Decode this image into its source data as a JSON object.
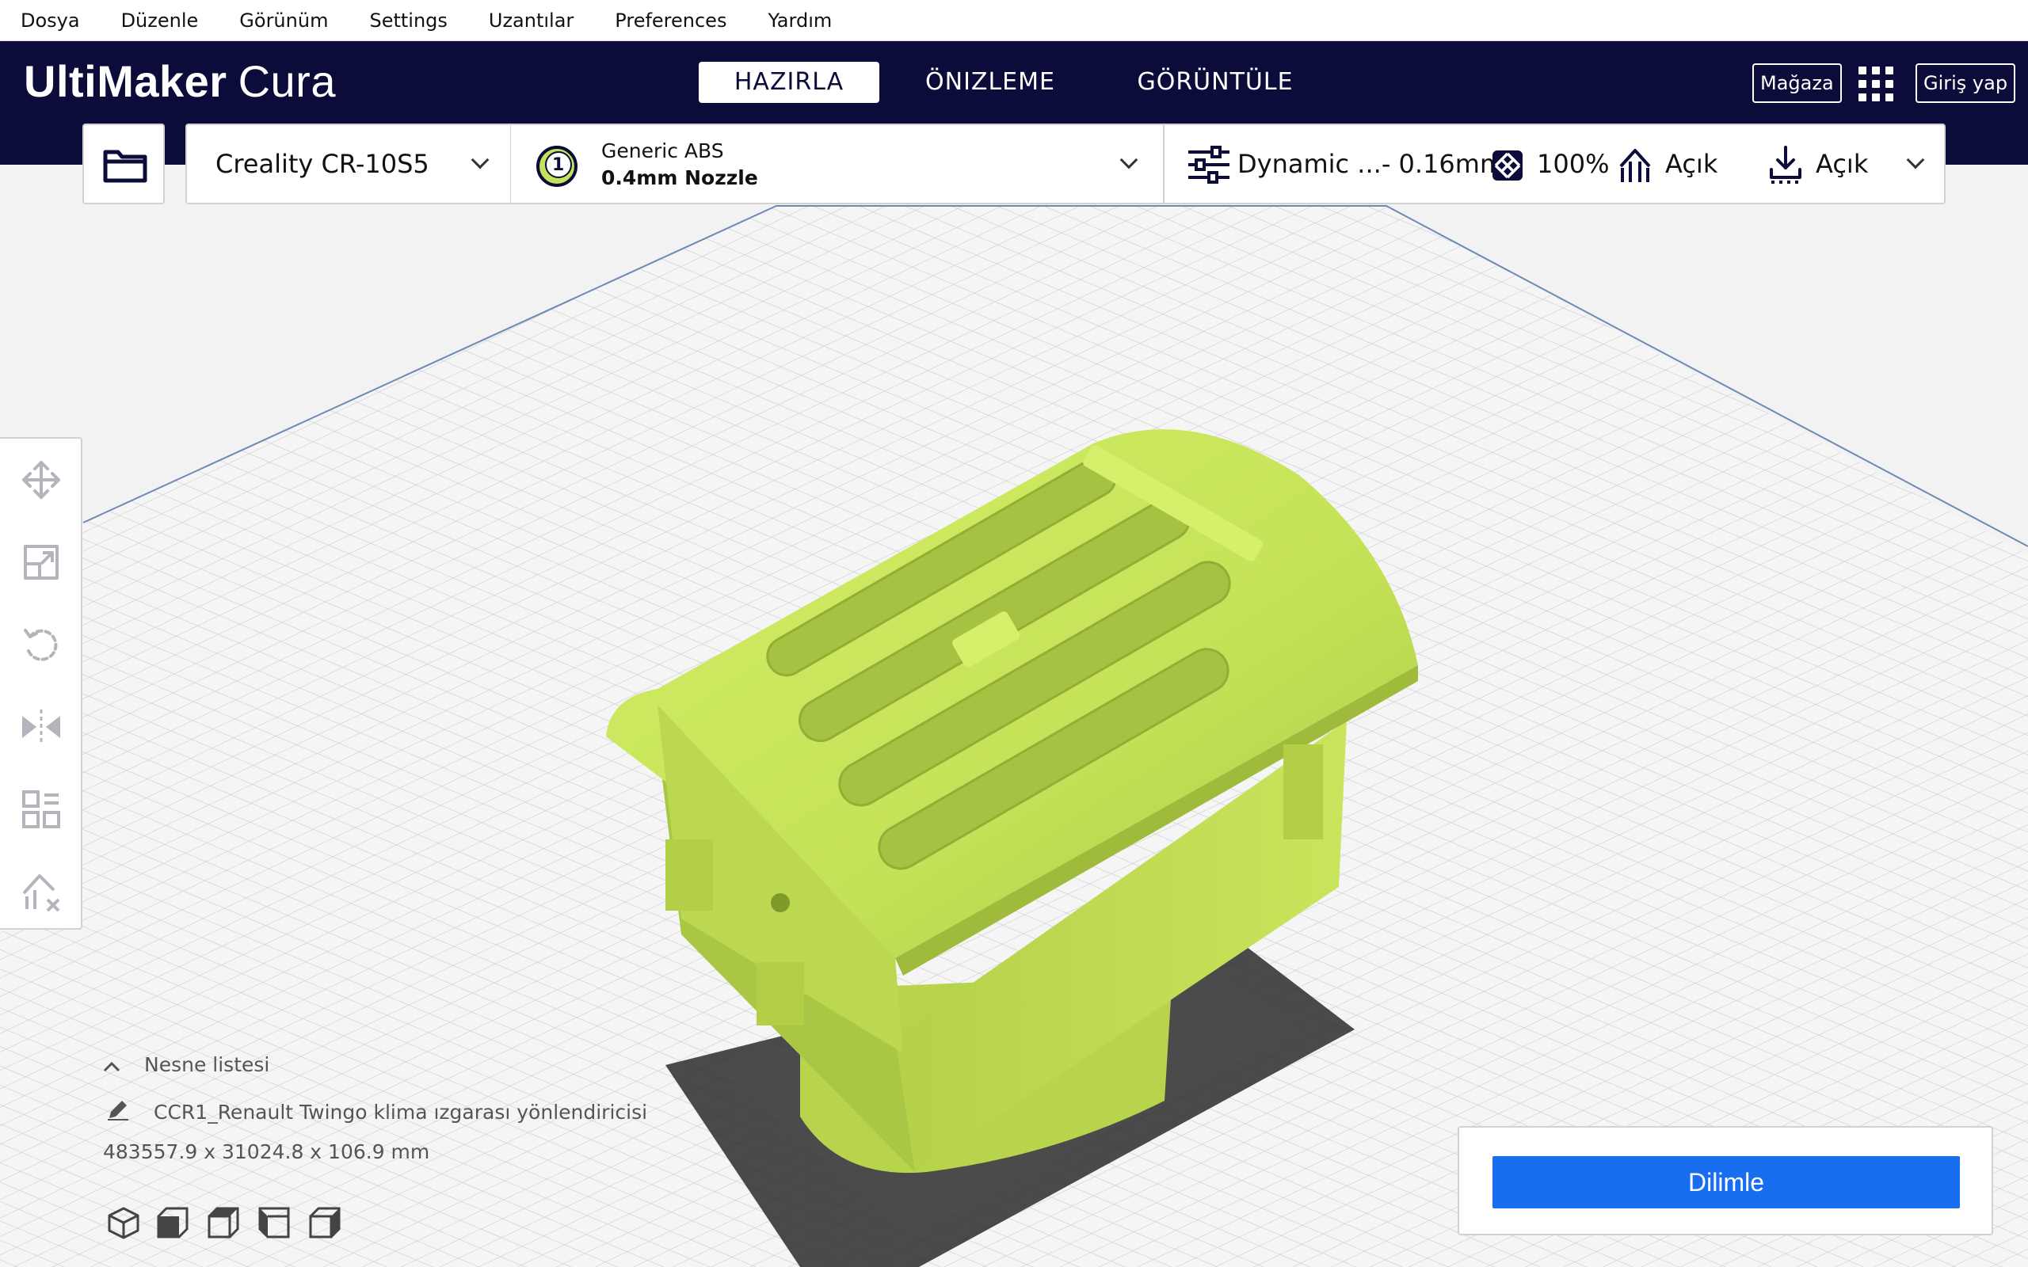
{
  "menu": [
    "Dosya",
    "Düzenle",
    "Görünüm",
    "Settings",
    "Uzantılar",
    "Preferences",
    "Yardım"
  ],
  "header": {
    "logo_bold": "UltiMaker",
    "logo_light": "Cura",
    "stages": [
      "HAZIRLA",
      "ÖNIZLEME",
      "GÖRÜNTÜLE"
    ],
    "active_stage": "HAZIRLA",
    "store_label": "Mağaza",
    "login_label": "Giriş yap"
  },
  "toolbar": {
    "printer": "Creality CR-10S5",
    "extruder_number": "1",
    "material": "Generic ABS",
    "nozzle": "0.4mm Nozzle",
    "profile": "Dynamic ...- 0.16mm",
    "infill": "100%",
    "support": "Açık",
    "adhesion": "Açık"
  },
  "tools": [
    "move-tool",
    "scale-tool",
    "rotate-tool",
    "mirror-tool",
    "per-model-settings-tool",
    "support-blocker-tool"
  ],
  "object_list": {
    "header": "Nesne listesi",
    "object_name": "CCR1_Renault Twingo klima ızgarası yönlendiricisi",
    "dimensions": "483557.9 x 31024.8 x 106.9 mm"
  },
  "slice": {
    "button_label": "Dilimle"
  },
  "colors": {
    "header_bg": "#0c0c3a",
    "accent": "#196ef0",
    "model": "#c5e35a",
    "model_shade": "#9fbb3c"
  }
}
